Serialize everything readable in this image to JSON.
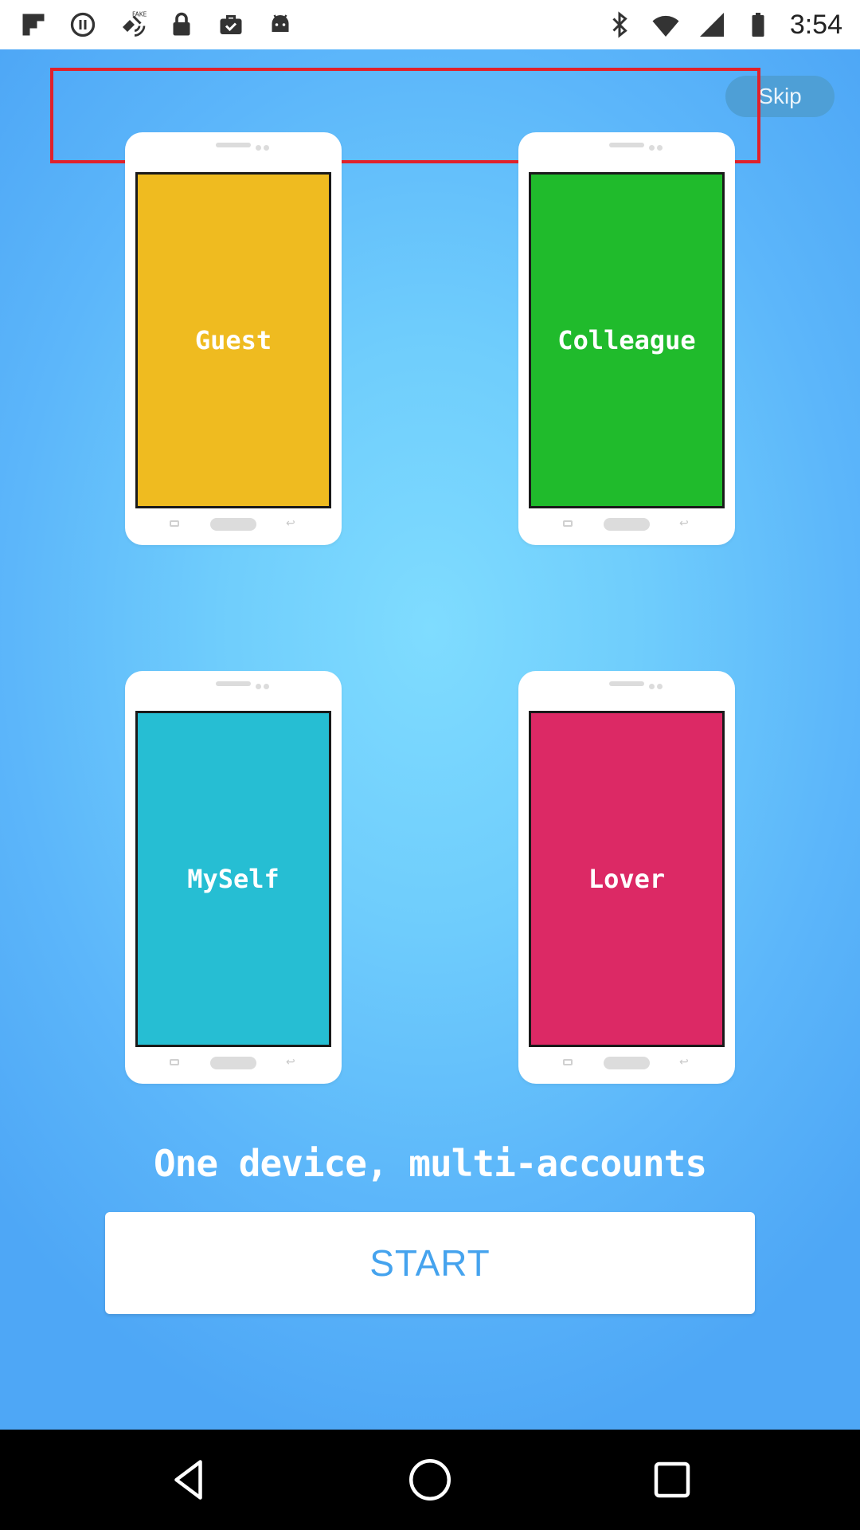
{
  "status_bar": {
    "time": "3:54",
    "left_icons": [
      "flipboard-icon",
      "data-saver-icon",
      "fake-gps-icon",
      "lock-icon",
      "briefcase-check-icon",
      "android-icon"
    ],
    "right_icons": [
      "bluetooth-icon",
      "wifi-icon",
      "signal-icon",
      "battery-icon"
    ]
  },
  "header": {
    "skip_label": "Skip"
  },
  "account_cards": [
    {
      "label": "Guest",
      "color": "#efbb20"
    },
    {
      "label": "Colleague",
      "color": "#20bb2c"
    },
    {
      "label": "MySelf",
      "color": "#26bed3"
    },
    {
      "label": "Lover",
      "color": "#dc2965"
    }
  ],
  "main": {
    "tagline": "One device, multi-accounts",
    "start_label": "START"
  },
  "nav_bar": {
    "buttons": [
      "back-icon",
      "home-icon",
      "recents-icon"
    ]
  },
  "colors": {
    "background_center": "#7fdcff",
    "background_edge": "#4ea7f6",
    "accent": "#45a3ee",
    "highlight": "#e0212b"
  }
}
